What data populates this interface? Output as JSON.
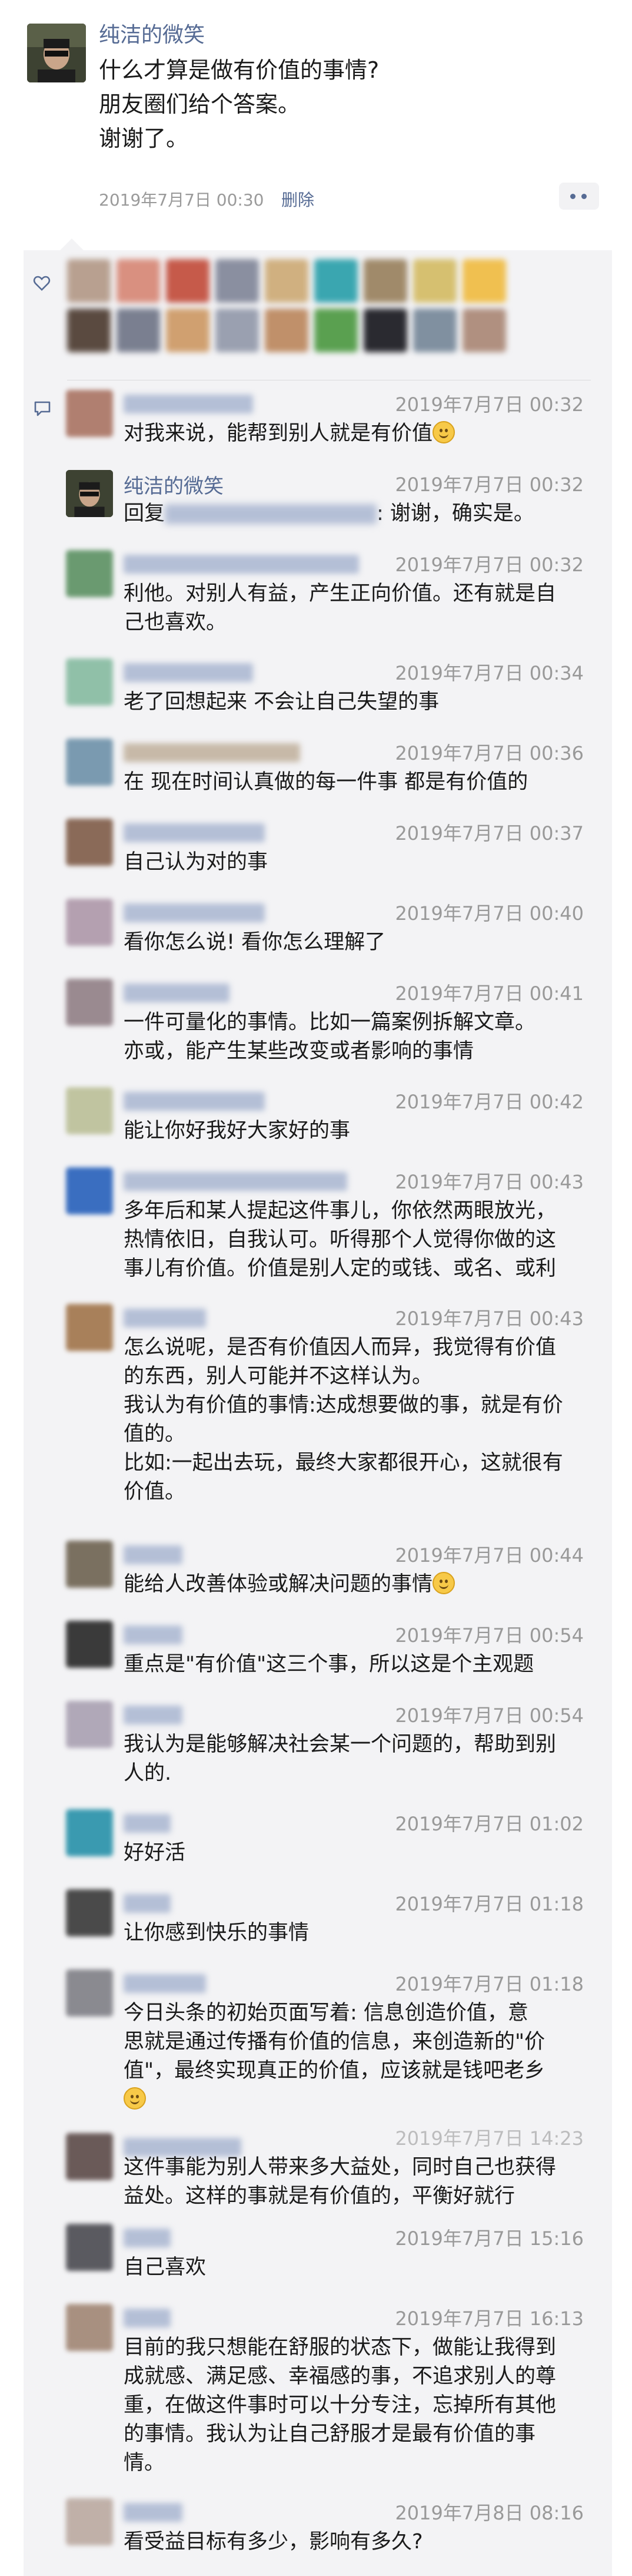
{
  "post": {
    "author": "纯洁的微笑",
    "text_lines": [
      "什么才算是做有价值的事情?",
      "朋友圈们给个答案。",
      "谢谢了。"
    ],
    "time": "2019年7月7日 00:30",
    "delete_label": "删除"
  },
  "icons": {
    "like": "heart-icon",
    "comment": "comment-bubble-icon",
    "more": "more-dots-icon"
  },
  "colors": {
    "link": "#566b94",
    "time": "#999999",
    "comment_bg": "#f3f3f5"
  },
  "comments": [
    {
      "time": "2019年7月7日 00:32",
      "lines": [
        "对我来说，能帮到别人就是有价值"
      ],
      "emoji_end": true
    },
    {
      "name": "纯洁的微笑",
      "time": "2019年7月7日 00:32",
      "reply_prefix": "回复",
      "lines": [
        ": 谢谢，确实是。"
      ]
    },
    {
      "time": "2019年7月7日 00:32",
      "lines": [
        "利他。对别人有益，产生正向价值。还有就是自",
        "己也喜欢。"
      ]
    },
    {
      "time": "2019年7月7日 00:34",
      "lines": [
        "老了回想起来 不会让自己失望的事"
      ]
    },
    {
      "time": "2019年7月7日 00:36",
      "lines": [
        "在 现在时间认真做的每一件事 都是有价值的"
      ]
    },
    {
      "time": "2019年7月7日 00:37",
      "lines": [
        "自己认为对的事"
      ]
    },
    {
      "time": "2019年7月7日 00:40",
      "lines": [
        "看你怎么说! 看你怎么理解了"
      ]
    },
    {
      "time": "2019年7月7日 00:41",
      "lines": [
        "一件可量化的事情。比如一篇案例拆解文章。",
        "亦或，能产生某些改变或者影响的事情"
      ]
    },
    {
      "time": "2019年7月7日 00:42",
      "lines": [
        "能让你好我好大家好的事"
      ]
    },
    {
      "time": "2019年7月7日 00:43",
      "lines": [
        "多年后和某人提起这件事儿，你依然两眼放光，",
        "热情依旧，自我认可。听得那个人觉得你做的这",
        "事儿有价值。价值是别人定的或钱、或名、或利"
      ]
    },
    {
      "time": "2019年7月7日 00:43",
      "lines": [
        "怎么说呢，是否有价值因人而异，我觉得有价值",
        "的东西，别人可能并不这样认为。",
        "我认为有价值的事情:达成想要做的事，就是有价",
        "值的。",
        "比如:一起出去玩，最终大家都很开心，这就很有",
        "价值。"
      ]
    },
    {
      "time": "2019年7月7日 00:44",
      "lines": [
        "能给人改善体验或解决问题的事情"
      ],
      "emoji_end": true
    },
    {
      "time": "2019年7月7日 00:54",
      "lines": [
        "重点是\"有价值\"这三个事，所以这是个主观题"
      ]
    },
    {
      "time": "2019年7月7日 00:54",
      "lines": [
        "我认为是能够解决社会某一个问题的，帮助到别",
        "人的."
      ]
    },
    {
      "time": "2019年7月7日 01:02",
      "lines": [
        "好好活"
      ]
    },
    {
      "time": "2019年7月7日 01:18",
      "lines": [
        "让你感到快乐的事情"
      ]
    },
    {
      "time": "2019年7月7日 01:18",
      "lines": [
        "今日头条的初始页面写着: 信息创造价值，意",
        "思就是通过传播有价值的信息，来创造新的\"价",
        "值\"，最终实现真正的价值，应该就是钱吧老乡"
      ],
      "emoji_newline": true
    },
    {
      "time": "2019年7月7日 14:23",
      "lines": [
        "这件事能为别人带来多大益处，同时自己也获得",
        "益处。这样的事就是有价值的，平衡好就行"
      ]
    },
    {
      "time": "2019年7月7日 15:16",
      "lines": [
        "自己喜欢"
      ]
    },
    {
      "time": "2019年7月7日 16:13",
      "lines": [
        "目前的我只想能在舒服的状态下，做能让我得到",
        "成就感、满足感、幸福感的事，不追求别人的尊",
        "重，在做这件事时可以十分专注，忘掉所有其他",
        "的事情。我认为让自己舒服才是最有价值的事",
        "情。"
      ]
    },
    {
      "time": "2019年7月8日 08:16",
      "lines": [
        "看受益目标有多少，影响有多久?"
      ]
    }
  ]
}
